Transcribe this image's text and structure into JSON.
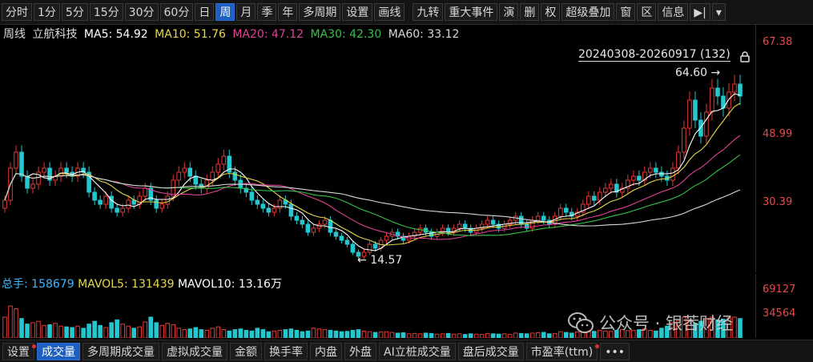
{
  "toolbar": {
    "periods": [
      "分时",
      "1分",
      "5分",
      "15分",
      "30分",
      "60分",
      "日",
      "周",
      "月",
      "季",
      "年",
      "多周期"
    ],
    "active_period": "周",
    "tools": [
      "设置",
      "画线"
    ],
    "right_tools": [
      "九转",
      "重大事件",
      "演",
      "删",
      "权",
      "超级叠加",
      "窗",
      "区",
      "信息"
    ]
  },
  "info": {
    "period": "周线",
    "stock_name": "立航科技",
    "ma5": "MA5: 54.92",
    "ma10": "MA10: 51.76",
    "ma20": "MA20: 47.12",
    "ma30": "MA30: 42.30",
    "ma60": "MA60: 33.12"
  },
  "colors": {
    "up": "#e53935",
    "down": "#22c7cf",
    "ma5": "#ffffff",
    "ma10": "#e8d94a",
    "ma20": "#e0429a",
    "ma30": "#35c14a",
    "ma60": "#d8d8d8"
  },
  "range": "20240308-20260917 (132)",
  "high_label": "64.60",
  "low_label": "14.57",
  "price_axis": [
    "67.38",
    "48.99",
    "30.39"
  ],
  "volume": {
    "total": "总手: 158679",
    "mavol5": "MAVOL5: 131439",
    "mavol10": "MAVOL10: 13.16万",
    "axis": [
      "69127",
      "34564"
    ]
  },
  "watermark": "公众号 · 银莕财经",
  "bottom_tabs": [
    "设置",
    "成交量",
    "多周期成交量",
    "虚拟成交量",
    "金额",
    "换手率",
    "内盘",
    "外盘",
    "AI立桩成交量",
    "盘后成交量",
    "市盈率(ttm)",
    "•••"
  ],
  "active_bottom": "成交量",
  "chart_data": {
    "type": "candlestick",
    "x_range": [
      "20240308",
      "20260917"
    ],
    "count": 132,
    "ylim": [
      12,
      70
    ],
    "high": 64.6,
    "low": 14.57,
    "ma_last": {
      "MA5": 54.92,
      "MA10": 51.76,
      "MA20": 47.12,
      "MA30": 42.3,
      "MA60": 33.12
    },
    "closes": [
      30,
      38,
      42,
      36,
      33,
      34,
      37,
      38,
      35,
      36,
      38,
      37,
      36,
      38,
      37,
      32,
      30,
      29,
      31,
      28,
      27,
      28,
      30,
      29,
      31,
      33,
      30,
      28,
      29,
      31,
      35,
      37,
      38,
      36,
      34,
      33,
      35,
      37,
      39,
      41,
      37,
      35,
      33,
      32,
      30,
      29,
      28,
      27,
      28,
      30,
      29,
      26,
      25,
      24,
      22,
      23,
      24,
      25,
      22,
      21,
      20,
      19,
      17,
      16,
      17,
      19,
      18,
      20,
      21,
      22,
      21,
      20,
      21,
      22,
      23,
      22,
      21,
      22,
      23,
      22,
      23,
      24,
      23,
      22,
      23,
      24,
      25,
      24,
      23,
      24,
      25,
      26,
      24,
      23,
      25,
      26,
      25,
      24,
      26,
      28,
      27,
      26,
      27,
      29,
      31,
      30,
      32,
      33,
      34,
      32,
      33,
      35,
      36,
      35,
      37,
      38,
      37,
      36,
      35,
      38,
      42,
      48,
      55,
      50,
      46,
      52,
      58,
      56,
      53,
      57,
      59,
      56
    ],
    "volumes": [
      30000,
      46000,
      42000,
      28000,
      20000,
      22000,
      24000,
      18000,
      19000,
      21000,
      17000,
      16000,
      15000,
      17000,
      14000,
      20000,
      24000,
      18000,
      15000,
      22000,
      26000,
      20000,
      17000,
      14000,
      16000,
      23000,
      30000,
      22000,
      18000,
      21000,
      19000,
      14000,
      12000,
      13000,
      15000,
      12000,
      11000,
      14000,
      16000,
      12000,
      10000,
      12000,
      13000,
      11000,
      10000,
      14000,
      12000,
      9000,
      10000,
      11000,
      12000,
      13000,
      11000,
      9000,
      10000,
      14000,
      13000,
      12000,
      11000,
      10000,
      9000,
      9500,
      11000,
      12000,
      10000,
      9000,
      8000,
      8500,
      9000,
      8000,
      7000,
      7500,
      6000,
      6500,
      6000,
      7000,
      6500,
      5500,
      6000,
      6500,
      5500,
      6000,
      5000,
      6000,
      5500,
      5000,
      6500,
      6000,
      5500,
      6000,
      5000,
      7000,
      6500,
      6000,
      7000,
      7500,
      8000,
      6000,
      6500,
      9000,
      8000,
      7000,
      8500,
      9000,
      10000,
      9500,
      11000,
      10000,
      9500,
      11000,
      12000,
      10500,
      11000,
      12000,
      13000,
      11000,
      10000,
      14000,
      17000,
      22000,
      25000,
      30000,
      26000,
      21000,
      24000,
      28000,
      30000,
      26000,
      27000,
      29000,
      30000,
      28000
    ]
  }
}
